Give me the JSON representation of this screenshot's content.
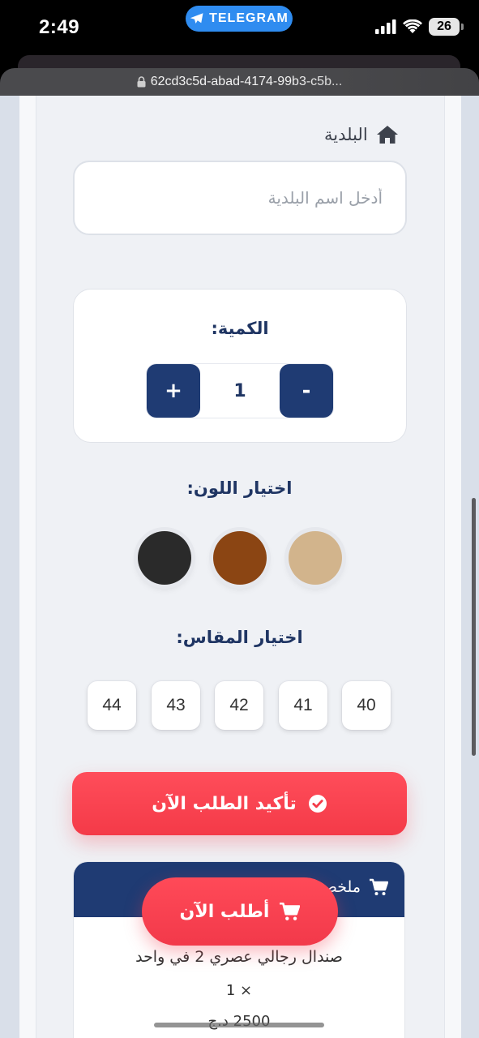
{
  "status_bar": {
    "time": "2:49",
    "app_pill": "TELEGRAM",
    "battery": "26"
  },
  "browser": {
    "url": "62cd3c5d-abad-4174-99b3-c5b..."
  },
  "form": {
    "municipality_label": "البلدية",
    "municipality_placeholder": "أدخل اسم البلدية",
    "quantity_label": "الكمية:",
    "quantity_value": "1",
    "plus_label": "+",
    "minus_label": "-",
    "color_label": "اختيار اللون:",
    "colors": [
      "#2a2a2a",
      "#8b4513",
      "#d2b48c"
    ],
    "size_label": "اختيار المقاس:",
    "sizes": [
      "44",
      "43",
      "42",
      "41",
      "40"
    ],
    "confirm_button": "تأكيد الطلب الآن"
  },
  "summary": {
    "title": "ملخص",
    "product": "صندال رجالي عصري 2 في واحد",
    "quantity": "× 1",
    "price": "2500 د.ج"
  },
  "floating": {
    "order_now": "أطلب الآن"
  },
  "theme": {
    "navy": "#1f3b73",
    "red": "#f43a48"
  }
}
